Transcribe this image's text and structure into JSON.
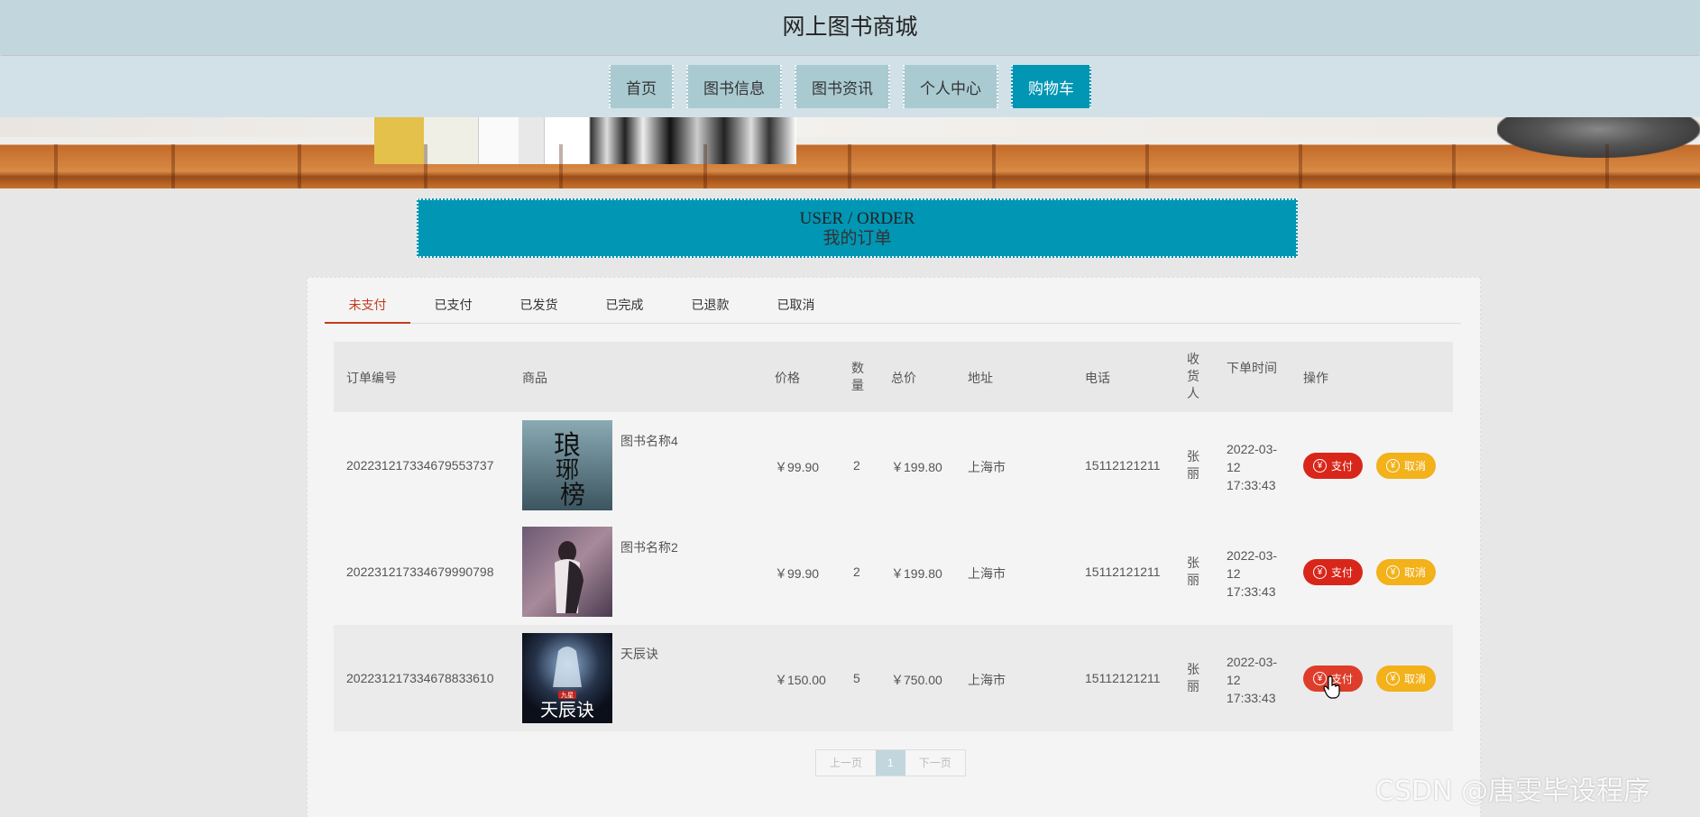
{
  "site": {
    "title": "网上图书商城"
  },
  "nav": {
    "items": [
      {
        "label": "首页"
      },
      {
        "label": "图书信息"
      },
      {
        "label": "图书资讯"
      },
      {
        "label": "个人中心"
      },
      {
        "label": "购物车"
      }
    ],
    "active_index": 4
  },
  "order_header": {
    "en": "USER / ORDER",
    "cn": "我的订单"
  },
  "tabs": [
    {
      "label": "未支付"
    },
    {
      "label": "已支付"
    },
    {
      "label": "已发货"
    },
    {
      "label": "已完成"
    },
    {
      "label": "已退款"
    },
    {
      "label": "已取消"
    }
  ],
  "active_tab": 0,
  "table": {
    "headers": {
      "order_no": "订单编号",
      "product": "商品",
      "price": "价格",
      "qty": "数量",
      "total": "总价",
      "address": "地址",
      "phone": "电话",
      "receiver": "收货人",
      "time": "下单时间",
      "actions": "操作"
    },
    "rows": [
      {
        "order_no": "20223121733467955373 7",
        "order_no_display": "202231217334679553737",
        "product": "图书名称4",
        "price": "￥99.90",
        "qty": "2",
        "total": "￥199.80",
        "address": "上海市",
        "phone": "15112121211",
        "receiver": "张丽",
        "time": "2022-03-12 17:33:43",
        "cover": "langya"
      },
      {
        "order_no_display": "202231217334679990798",
        "product": "图书名称2",
        "price": "￥99.90",
        "qty": "2",
        "total": "￥199.80",
        "address": "上海市",
        "phone": "15112121211",
        "receiver": "张丽",
        "time": "2022-03-12 17:33:43",
        "cover": "couple"
      },
      {
        "order_no_display": "202231217334678833610",
        "product": "天辰诀",
        "price": "￥150.00",
        "qty": "5",
        "total": "￥750.00",
        "address": "上海市",
        "phone": "15112121211",
        "receiver": "张丽",
        "time": "2022-03-12 17:33:43",
        "cover": "tianchen"
      }
    ],
    "buttons": {
      "pay": "支付",
      "cancel": "取消",
      "yen": "¥"
    }
  },
  "pager": {
    "prev": "上一页",
    "current": "1",
    "next": "下一页"
  },
  "watermark": "CSDN @唐雯毕设程序",
  "colors": {
    "accent": "#0096b4",
    "pay": "#d9261a",
    "cancel": "#f3b11a",
    "active_tab": "#c8391f"
  }
}
